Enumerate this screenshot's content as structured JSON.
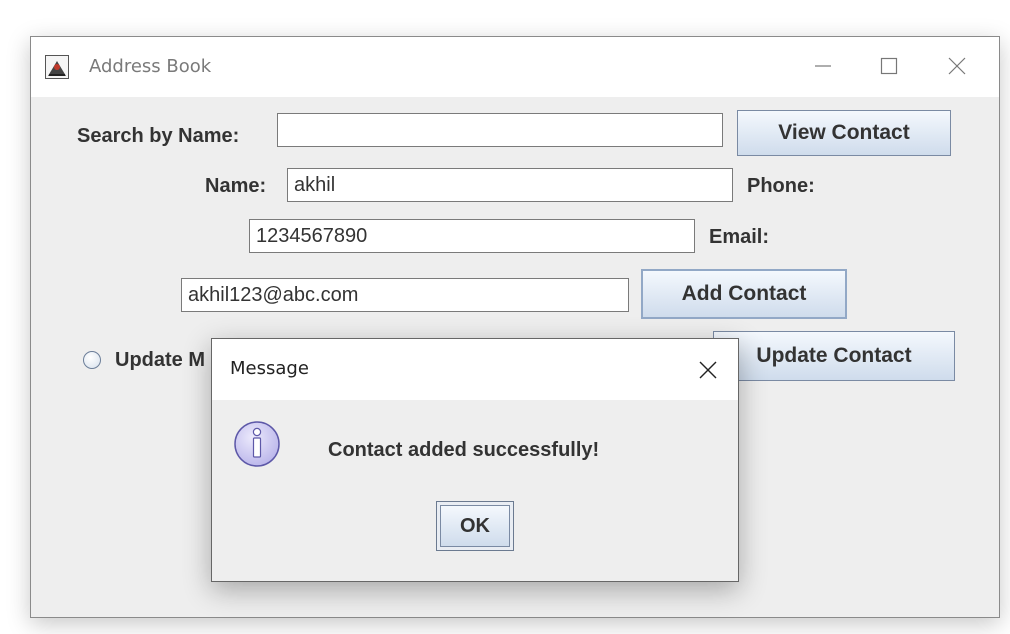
{
  "window": {
    "title": "Address Book",
    "app_icon": "java-duke-icon",
    "controls": [
      "minimize-icon",
      "maximize-icon",
      "close-icon"
    ]
  },
  "form": {
    "search_label": "Search by Name:",
    "search_value": "",
    "view_button": "View Contact",
    "name_label": "Name:",
    "name_value": "akhil",
    "phone_label": "Phone:",
    "phone_value": "1234567890",
    "email_label": "Email:",
    "email_value": "akhil123@abc.com",
    "add_button": "Add Contact",
    "update_radio_label": "Update M",
    "update_radio_selected": false,
    "update_button": "Update Contact"
  },
  "dialog": {
    "title": "Message",
    "icon": "info-icon",
    "message": "Contact added successfully!",
    "ok_button": "OK"
  },
  "colors": {
    "window_bg": "#eeeeee",
    "titlebar_bg": "#ffffff",
    "button_gradient_top": "#f4f8fd",
    "button_gradient_bottom": "#cfdcec",
    "info_icon_fill": "#c9c6ef"
  }
}
